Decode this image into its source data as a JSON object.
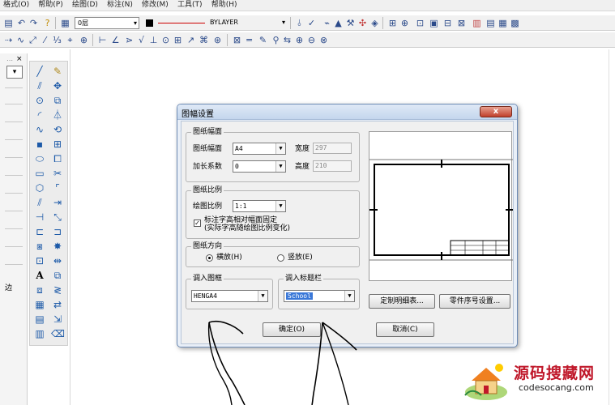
{
  "menubar": {
    "items": [
      "格式(O)",
      "帮助(P)",
      "绘图(D)",
      "标注(N)",
      "修改(M)",
      "工具(T)",
      "帮助(H)"
    ]
  },
  "toolbar": {
    "layer_value": "0层",
    "linetype_value": "BYLAYER"
  },
  "left_panel": {
    "close_glyph": "×",
    "dropdown_glyph": "▾",
    "text_fragment": "边"
  },
  "dialog": {
    "title": "图幅设置",
    "close_glyph": "x",
    "paper_group": {
      "label": "图纸幅面",
      "size_label": "图纸幅面",
      "size_value": "A4",
      "factor_label": "加长系数",
      "factor_value": "0",
      "width_label": "宽度",
      "width_value": "297",
      "height_label": "高度",
      "height_value": "210"
    },
    "scale_group": {
      "label": "图纸比例",
      "scale_label": "绘图比例",
      "scale_value": "1:1",
      "check_text_line1": "标注字高相对幅面固定",
      "check_text_line2": "(实际字高随绘图比例变化)",
      "checked": true
    },
    "orient_group": {
      "label": "图纸方向",
      "landscape": "横放(H)",
      "portrait": "竖放(E)",
      "selected": "landscape"
    },
    "frame_group": {
      "label": "调入图框",
      "value": "HENGA4"
    },
    "titleblock_group": {
      "label": "调入标题栏",
      "value": "School"
    },
    "buttons": {
      "detail_table": "定制明细表...",
      "part_number": "零件序号设置...",
      "ok": "确定(O)",
      "cancel": "取消(C)"
    }
  },
  "watermark": {
    "cn": "源码搜藏网",
    "en": "codesocang.com"
  },
  "colors": {
    "dialog_bg": "#f0f0f0",
    "titlebar": "#c4d6ed",
    "close_red": "#c0402c",
    "selected_blue": "#3a78d8",
    "watermark_red": "#c0182a"
  }
}
